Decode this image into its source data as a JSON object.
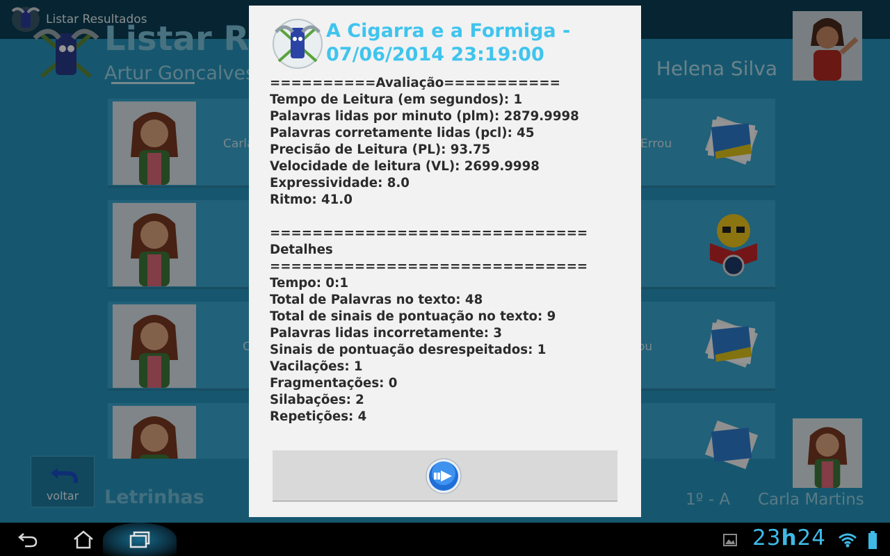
{
  "app": {
    "window_title": "Listar Resultados",
    "header_title": "Listar Resultados",
    "student_name": "Artur Goncalves",
    "teacher_name": "Helena Silva",
    "rows": [
      {
        "left_text": "Carla",
        "right_text": "Errou",
        "icon": "photo-stack-icon"
      },
      {
        "left_text": "",
        "right_text": "",
        "icon": "reading-smiley-icon"
      },
      {
        "left_text": "C",
        "right_text": "ou",
        "icon": "photo-stack-icon"
      },
      {
        "left_text": "",
        "right_text": "",
        "icon": "photo-stack-icon"
      }
    ],
    "back_label": "voltar",
    "footer_app_name": "Letrinhas",
    "footer_class": "1º - A",
    "footer_user": "Carla Martins"
  },
  "dialog": {
    "title": "A Cigarra e a Formiga - 07/06/2014 23:19:00",
    "evaluation_header": "==========Avaliação===========",
    "evaluation": [
      "Tempo de Leitura (em segundos): 1",
      "Palavras lidas por minuto (plm): 2879.9998",
      "Palavras corretamente lidas (pcl): 45",
      "Precisão de Leitura (PL): 93.75",
      "Velocidade de leitura (VL): 2699.9998",
      "Expressividade: 8.0",
      "Ritmo: 41.0"
    ],
    "separator": "==============================",
    "details_header": "Detalhes",
    "details": [
      "Tempo: 0:1",
      "Total de Palavras no texto: 48",
      "Total de sinais de pontuação no texto: 9",
      "Palavras lidas incorretamente: 3",
      "Sinais de pontuação desrespeitados: 1",
      "Vacilações: 1",
      "Fragmentações: 0",
      "Silabações: 2",
      "Repetições: 4"
    ],
    "next_button_icon": "arrow-right-circle-icon"
  },
  "status_bar": {
    "clock_hours": "23",
    "clock_sep": "h",
    "clock_minutes": "24"
  },
  "colors": {
    "accent": "#3fc4ee",
    "app_background": "#2696bf",
    "dialog_background": "#f2f2f2"
  }
}
